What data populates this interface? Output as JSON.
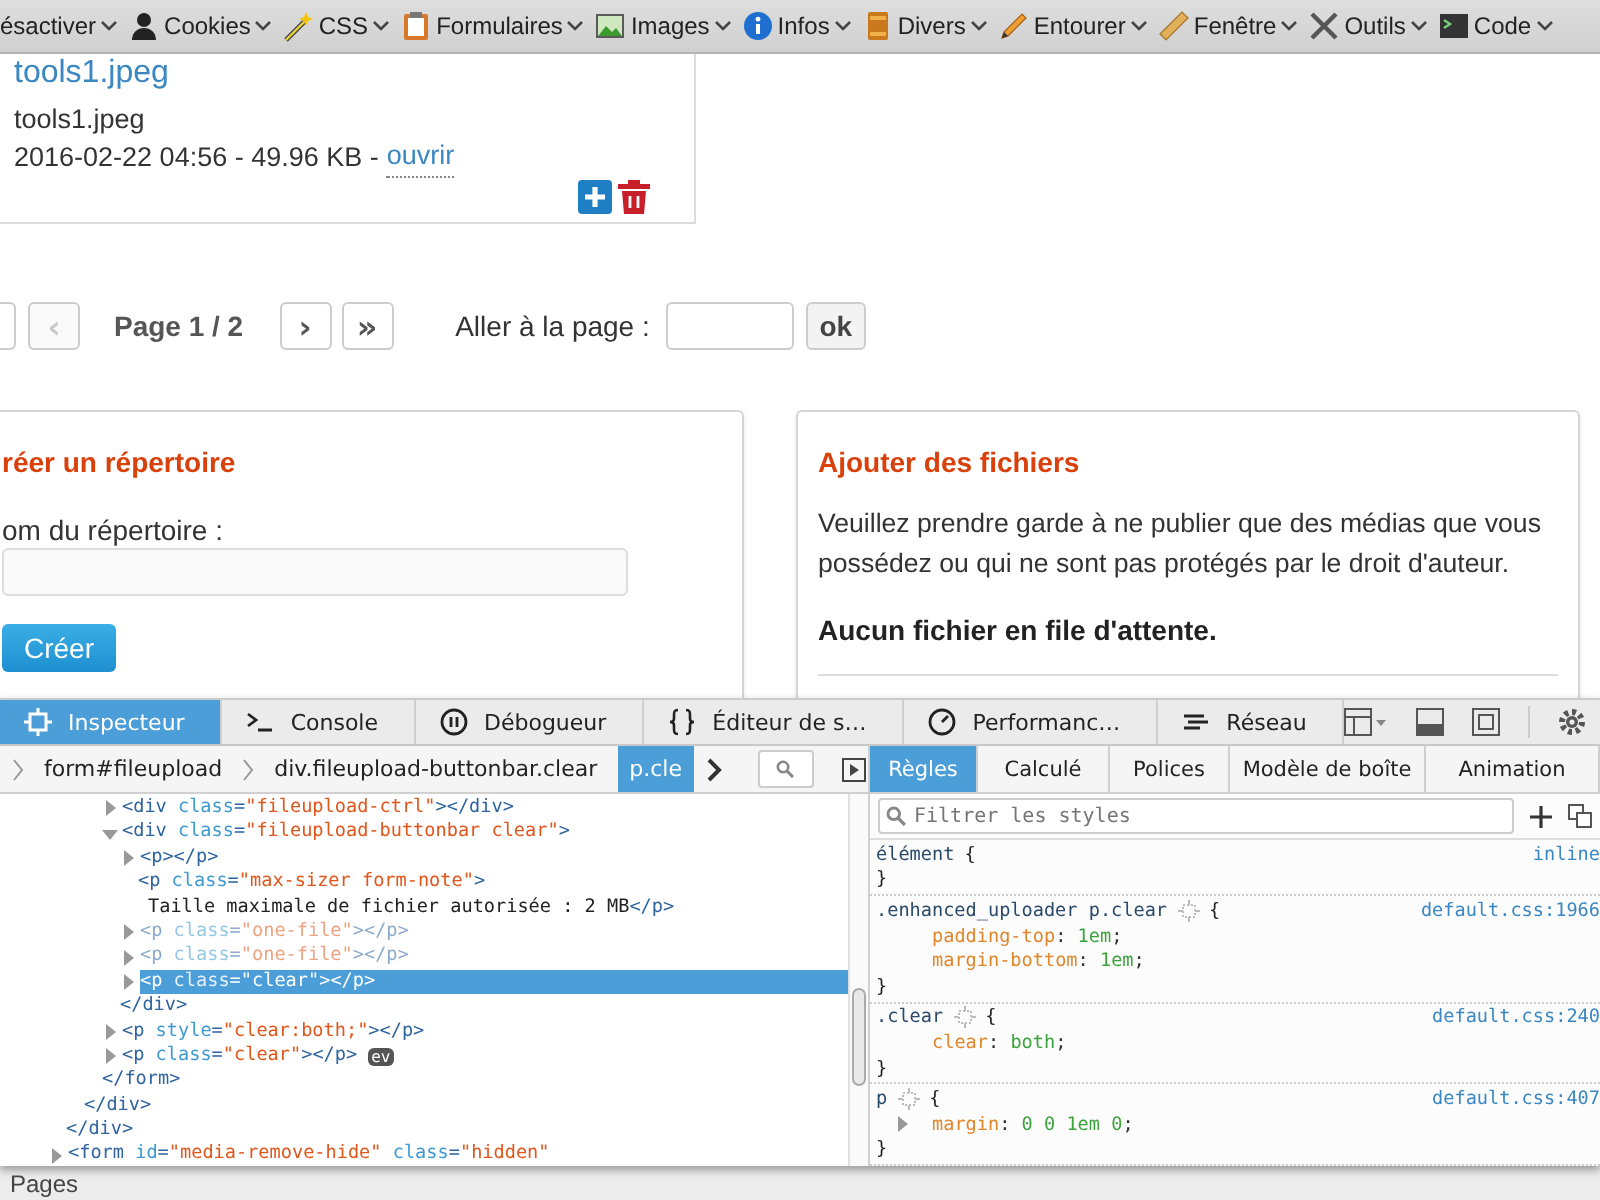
{
  "toolbar": {
    "items": [
      {
        "label": "ésactiver",
        "kind": "none"
      },
      {
        "label": "Cookies",
        "kind": "person"
      },
      {
        "label": "CSS",
        "kind": "wand"
      },
      {
        "label": "Formulaires",
        "kind": "clipboard"
      },
      {
        "label": "Images",
        "kind": "image"
      },
      {
        "label": "Infos",
        "kind": "info"
      },
      {
        "label": "Divers",
        "kind": "book"
      },
      {
        "label": "Entourer",
        "kind": "pencil"
      },
      {
        "label": "Fenêtre",
        "kind": "ruler"
      },
      {
        "label": "Outils",
        "kind": "tools"
      },
      {
        "label": "Code",
        "kind": "terminal"
      }
    ]
  },
  "file_card": {
    "title": "tools1.jpeg",
    "filename": "tools1.jpeg",
    "meta": "2016-02-22 04:56 - 49.96 KB -",
    "open_link": "ouvrir"
  },
  "pagination": {
    "prev_buttons": [
      {
        "label": "‹",
        "disabled": true
      }
    ],
    "page_label": "Page 1 / 2",
    "next_buttons": [
      {
        "label": "›",
        "disabled": false
      },
      {
        "label": "»",
        "disabled": false
      }
    ],
    "goto_label": "Aller à la page :",
    "goto_button": "ok"
  },
  "create_folder": {
    "title": "réer un répertoire",
    "field_label": "om du répertoire :",
    "button": "Créer"
  },
  "add_files": {
    "title": "Ajouter des fichiers",
    "notice": "Veuillez prendre garde à ne publier que des médias que vous possédez ou qui ne sont pas protégés par le droit d'auteur.",
    "queue_status": "Aucun fichier en file d'attente."
  },
  "devtools": {
    "tabs": [
      {
        "label": "Inspecteur",
        "kind": "inspector",
        "selected": true
      },
      {
        "label": "Console",
        "kind": "console",
        "selected": false
      },
      {
        "label": "Débogueur",
        "kind": "debugger",
        "selected": false
      },
      {
        "label": "Éditeur de s…",
        "kind": "braces",
        "selected": false
      },
      {
        "label": "Performanc…",
        "kind": "gauge",
        "selected": false
      },
      {
        "label": "Réseau",
        "kind": "network",
        "selected": false
      }
    ],
    "breadcrumbs": [
      {
        "label": "form#fileupload",
        "selected": false
      },
      {
        "label": "div.fileupload-buttonbar.clear",
        "selected": false
      },
      {
        "label": "p.cle",
        "selected": true
      }
    ],
    "markup": [
      {
        "close": "</div>",
        "children": [
          {
            "close": "</div>",
            "children": [
              {
                "close": "</form>",
                "children": [
                  {
                    "tokens": [
                      {
                        "kind": "tag",
                        "text": "<div"
                      },
                      {
                        "kind": "attr",
                        "text": " class"
                      },
                      {
                        "kind": "tag",
                        "text": "="
                      },
                      {
                        "kind": "val",
                        "text": "\"fileupload-ctrl\""
                      },
                      {
                        "kind": "tag",
                        "text": "></div>"
                      }
                    ],
                    "expanded": false,
                    "selected": false,
                    "hidden": false
                  },
                  {
                    "tokens": [
                      {
                        "kind": "tag",
                        "text": "<div"
                      },
                      {
                        "kind": "attr",
                        "text": " class"
                      },
                      {
                        "kind": "tag",
                        "text": "="
                      },
                      {
                        "kind": "val",
                        "text": "\"fileupload-buttonbar clear\""
                      },
                      {
                        "kind": "tag",
                        "text": ">"
                      }
                    ],
                    "expanded": true,
                    "selected": false,
                    "hidden": false,
                    "close": "</div>",
                    "children": [
                      {
                        "tokens": [
                          {
                            "kind": "tag",
                            "text": "<p></p>"
                          }
                        ],
                        "expanded": false,
                        "selected": false,
                        "hidden": false
                      },
                      {
                        "tokens": [
                          {
                            "kind": "tag",
                            "text": "<p"
                          },
                          {
                            "kind": "attr",
                            "text": " class"
                          },
                          {
                            "kind": "tag",
                            "text": "="
                          },
                          {
                            "kind": "val",
                            "text": "\"max-sizer form-note\""
                          },
                          {
                            "kind": "tag",
                            "text": ">"
                          }
                        ],
                        "content": [
                          {
                            "kind": "txt",
                            "text": "Taille maximale de fichier autorisée : 2 MB"
                          },
                          {
                            "kind": "tag",
                            "text": "</p>"
                          }
                        ],
                        "selected": false,
                        "hidden": false
                      },
                      {
                        "tokens": [
                          {
                            "kind": "tag",
                            "text": "<p"
                          },
                          {
                            "kind": "attr",
                            "text": " class"
                          },
                          {
                            "kind": "tag",
                            "text": "="
                          },
                          {
                            "kind": "val",
                            "text": "\"one-file\""
                          },
                          {
                            "kind": "tag",
                            "text": "></p>"
                          }
                        ],
                        "expanded": false,
                        "selected": false,
                        "hidden": true
                      },
                      {
                        "tokens": [
                          {
                            "kind": "tag",
                            "text": "<p"
                          },
                          {
                            "kind": "attr",
                            "text": " class"
                          },
                          {
                            "kind": "tag",
                            "text": "="
                          },
                          {
                            "kind": "val",
                            "text": "\"one-file\""
                          },
                          {
                            "kind": "tag",
                            "text": "></p>"
                          }
                        ],
                        "expanded": false,
                        "selected": false,
                        "hidden": true
                      },
                      {
                        "tokens": [
                          {
                            "kind": "tag",
                            "text": "<p"
                          },
                          {
                            "kind": "attr",
                            "text": " class"
                          },
                          {
                            "kind": "tag",
                            "text": "="
                          },
                          {
                            "kind": "val",
                            "text": "\"clear\""
                          },
                          {
                            "kind": "tag",
                            "text": "></p>"
                          }
                        ],
                        "expanded": false,
                        "selected": true,
                        "hidden": false
                      }
                    ]
                  },
                  {
                    "tokens": [
                      {
                        "kind": "tag",
                        "text": "<p"
                      },
                      {
                        "kind": "attr",
                        "text": " style"
                      },
                      {
                        "kind": "tag",
                        "text": "="
                      },
                      {
                        "kind": "val",
                        "text": "\"clear:both;\""
                      },
                      {
                        "kind": "tag",
                        "text": "></p>"
                      }
                    ],
                    "expanded": false,
                    "selected": false,
                    "hidden": false
                  },
                  {
                    "tokens": [
                      {
                        "kind": "tag",
                        "text": "<p"
                      },
                      {
                        "kind": "attr",
                        "text": " class"
                      },
                      {
                        "kind": "tag",
                        "text": "="
                      },
                      {
                        "kind": "val",
                        "text": "\"clear\""
                      },
                      {
                        "kind": "tag",
                        "text": "></p>"
                      }
                    ],
                    "expanded": false,
                    "selected": false,
                    "hidden": false,
                    "badge": "ev"
                  }
                ]
              }
            ]
          }
        ]
      },
      {
        "tokens": [
          {
            "kind": "tag",
            "text": "<form"
          },
          {
            "kind": "attr",
            "text": " id"
          },
          {
            "kind": "tag",
            "text": "="
          },
          {
            "kind": "val",
            "text": "\"media-remove-hide\""
          },
          {
            "kind": "attr",
            "text": " class"
          },
          {
            "kind": "tag",
            "text": "="
          },
          {
            "kind": "val",
            "text": "\"hidden\""
          }
        ],
        "expanded": false,
        "selected": false,
        "hidden": false
      }
    ],
    "side_tabs": [
      {
        "label": "Règles",
        "selected": true
      },
      {
        "label": "Calculé",
        "selected": false
      },
      {
        "label": "Polices",
        "selected": false
      },
      {
        "label": "Modèle de boîte",
        "selected": false
      },
      {
        "label": "Animation",
        "selected": false
      }
    ],
    "filter_placeholder": "Filtrer les styles",
    "rules": [
      {
        "selector": "élément",
        "source": "inline",
        "marker": false,
        "open": "{",
        "close": "}"
      },
      {
        "selector": ".enhanced_uploader p.clear",
        "source": "default.css:1966",
        "marker": true,
        "open": "{",
        "close": "}",
        "declarations": [
          {
            "tokens": [
              {
                "kind": "prop",
                "text": "padding-top"
              },
              {
                "kind": "punc",
                "text": ":"
              },
              {
                "kind": "num",
                "text": " 1em"
              },
              {
                "kind": "punc",
                "text": ";"
              }
            ],
            "expandable": false
          },
          {
            "tokens": [
              {
                "kind": "prop",
                "text": "margin-bottom"
              },
              {
                "kind": "punc",
                "text": ":"
              },
              {
                "kind": "num",
                "text": " 1em"
              },
              {
                "kind": "punc",
                "text": ";"
              }
            ],
            "expandable": false
          }
        ]
      },
      {
        "selector": ".clear",
        "source": "default.css:240",
        "marker": true,
        "open": "{",
        "close": "}",
        "declarations": [
          {
            "tokens": [
              {
                "kind": "prop",
                "text": "clear"
              },
              {
                "kind": "punc",
                "text": ":"
              },
              {
                "kind": "num",
                "text": " both"
              },
              {
                "kind": "punc",
                "text": ";"
              }
            ],
            "expandable": false
          }
        ]
      },
      {
        "selector": "p",
        "source": "default.css:407",
        "marker": true,
        "open": "{",
        "close": "}",
        "declarations": [
          {
            "tokens": [
              {
                "kind": "prop",
                "text": "margin"
              },
              {
                "kind": "punc",
                "text": ":"
              },
              {
                "kind": "num",
                "text": " 0 0 1em 0"
              },
              {
                "kind": "punc",
                "text": ";"
              }
            ],
            "expandable": true
          }
        ]
      }
    ]
  },
  "background": {
    "label": "Pages"
  }
}
